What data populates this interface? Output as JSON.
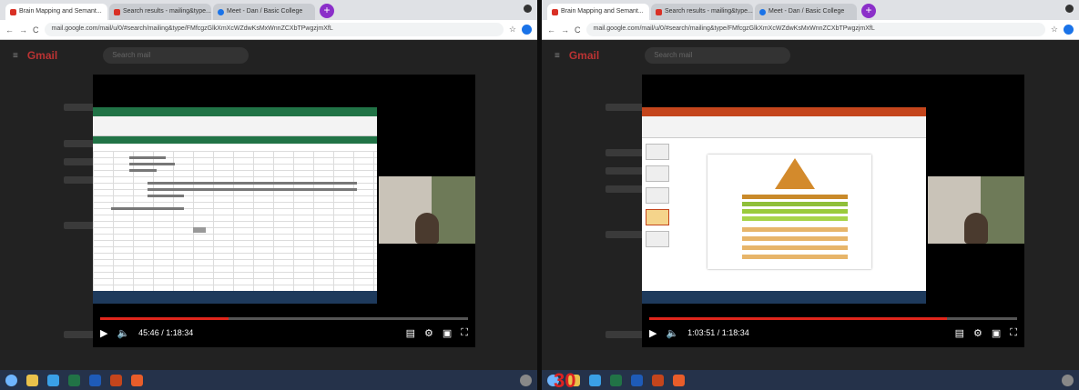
{
  "left": {
    "tabs": [
      {
        "label": "Brain Mapping and Semant..."
      },
      {
        "label": "Search results - mailing&type..."
      },
      {
        "label": "Meet - Dan / Basic College"
      }
    ],
    "url": "mail.google.com/mail/u/0/#search/mailing&type/FMfcgzGlkXmXcWZdwKsMxWnnZCXbTPwgzjmXfL",
    "gmail_label": "Gmail",
    "gmail_search": "Search mail",
    "video_time": "45:46 / 1:18:34",
    "progress": 0.35
  },
  "right": {
    "tabs": [
      {
        "label": "Brain Mapping and Semant..."
      },
      {
        "label": "Search results - mailing&type..."
      },
      {
        "label": "Meet - Dan / Basic College"
      }
    ],
    "url": "mail.google.com/mail/u/0/#search/mailing&type/FMfcgzGlkXmXcWZdwKsMxWnnZCXbTPwgzjmXfL",
    "gmail_label": "Gmail",
    "gmail_search": "Search mail",
    "video_time": "1:03:51 / 1:18:34",
    "progress": 0.81
  },
  "overlay_number": "30",
  "colors": {
    "accent": "#e1261c",
    "excel": "#217346",
    "powerpoint": "#c4451c"
  }
}
